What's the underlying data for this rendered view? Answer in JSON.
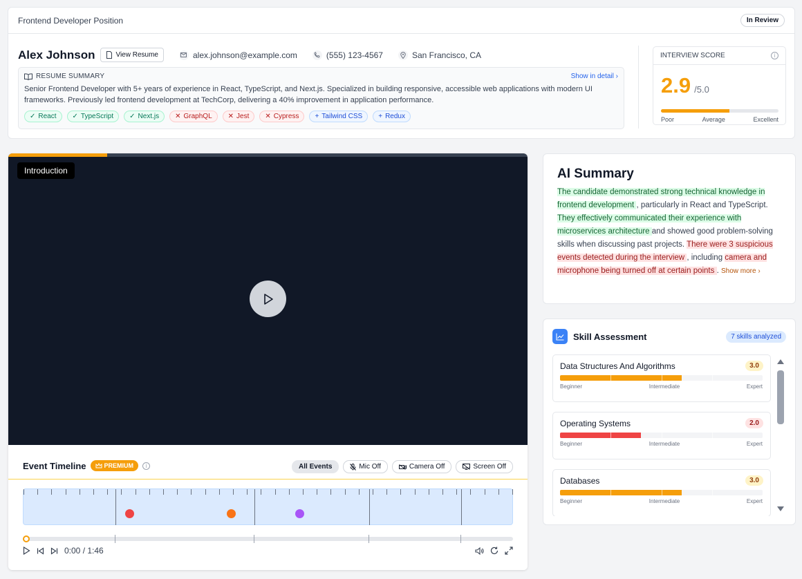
{
  "header": {
    "position_title": "Frontend Developer Position",
    "status": "In Review"
  },
  "candidate": {
    "name": "Alex Johnson",
    "view_resume_label": "View Resume",
    "email": "alex.johnson@example.com",
    "phone": "(555) 123-4567",
    "location": "San Francisco, CA"
  },
  "resume_summary": {
    "title": "RESUME SUMMARY",
    "show_detail": "Show in detail",
    "text": "Senior Frontend Developer with 5+ years of experience in React, TypeScript, and Next.js. Specialized in building responsive, accessible web applications with modern UI frameworks. Previously led frontend development at TechCorp, delivering a 40% improvement in application performance.",
    "tags": [
      {
        "label": "React",
        "kind": "match"
      },
      {
        "label": "TypeScript",
        "kind": "match"
      },
      {
        "label": "Next.js",
        "kind": "match"
      },
      {
        "label": "GraphQL",
        "kind": "missing"
      },
      {
        "label": "Jest",
        "kind": "missing"
      },
      {
        "label": "Cypress",
        "kind": "missing"
      },
      {
        "label": "Tailwind CSS",
        "kind": "extra"
      },
      {
        "label": "Redux",
        "kind": "extra"
      }
    ]
  },
  "interview_score": {
    "title": "INTERVIEW SCORE",
    "value": "2.9",
    "max": "/5.0",
    "fraction": 0.58,
    "scale": [
      "Poor",
      "Average",
      "Excellent"
    ],
    "color": "#f59e0b"
  },
  "video": {
    "chapter": "Introduction",
    "progress_fraction": 0.19
  },
  "timeline": {
    "title": "Event Timeline",
    "premium_label": "PREMIUM",
    "filters": [
      "All Events",
      "Mic Off",
      "Camera Off",
      "Screen Off"
    ],
    "time": "0:00 / 1:46",
    "events": [
      {
        "type": "event",
        "color": "#ef4444",
        "fraction": 0.217
      },
      {
        "type": "event",
        "color": "#f97316",
        "fraction": 0.424
      },
      {
        "type": "event",
        "color": "#a855f7",
        "fraction": 0.565
      }
    ]
  },
  "ai_summary": {
    "title": "AI Summary",
    "show_more": "Show more"
  },
  "skill_assessment": {
    "title": "Skill Assessment",
    "count_label": "7 skills analyzed",
    "scale": [
      "Beginner",
      "Intermediate",
      "Expert"
    ],
    "items": [
      {
        "name": "Data Structures And Algorithms",
        "score": "3.0",
        "fraction": 0.6,
        "color": "#f59e0b",
        "badge": "amber"
      },
      {
        "name": "Operating Systems",
        "score": "2.0",
        "fraction": 0.4,
        "color": "#ef4444",
        "badge": "red"
      },
      {
        "name": "Databases",
        "score": "3.0",
        "fraction": 0.6,
        "color": "#f59e0b",
        "badge": "amber"
      }
    ]
  }
}
